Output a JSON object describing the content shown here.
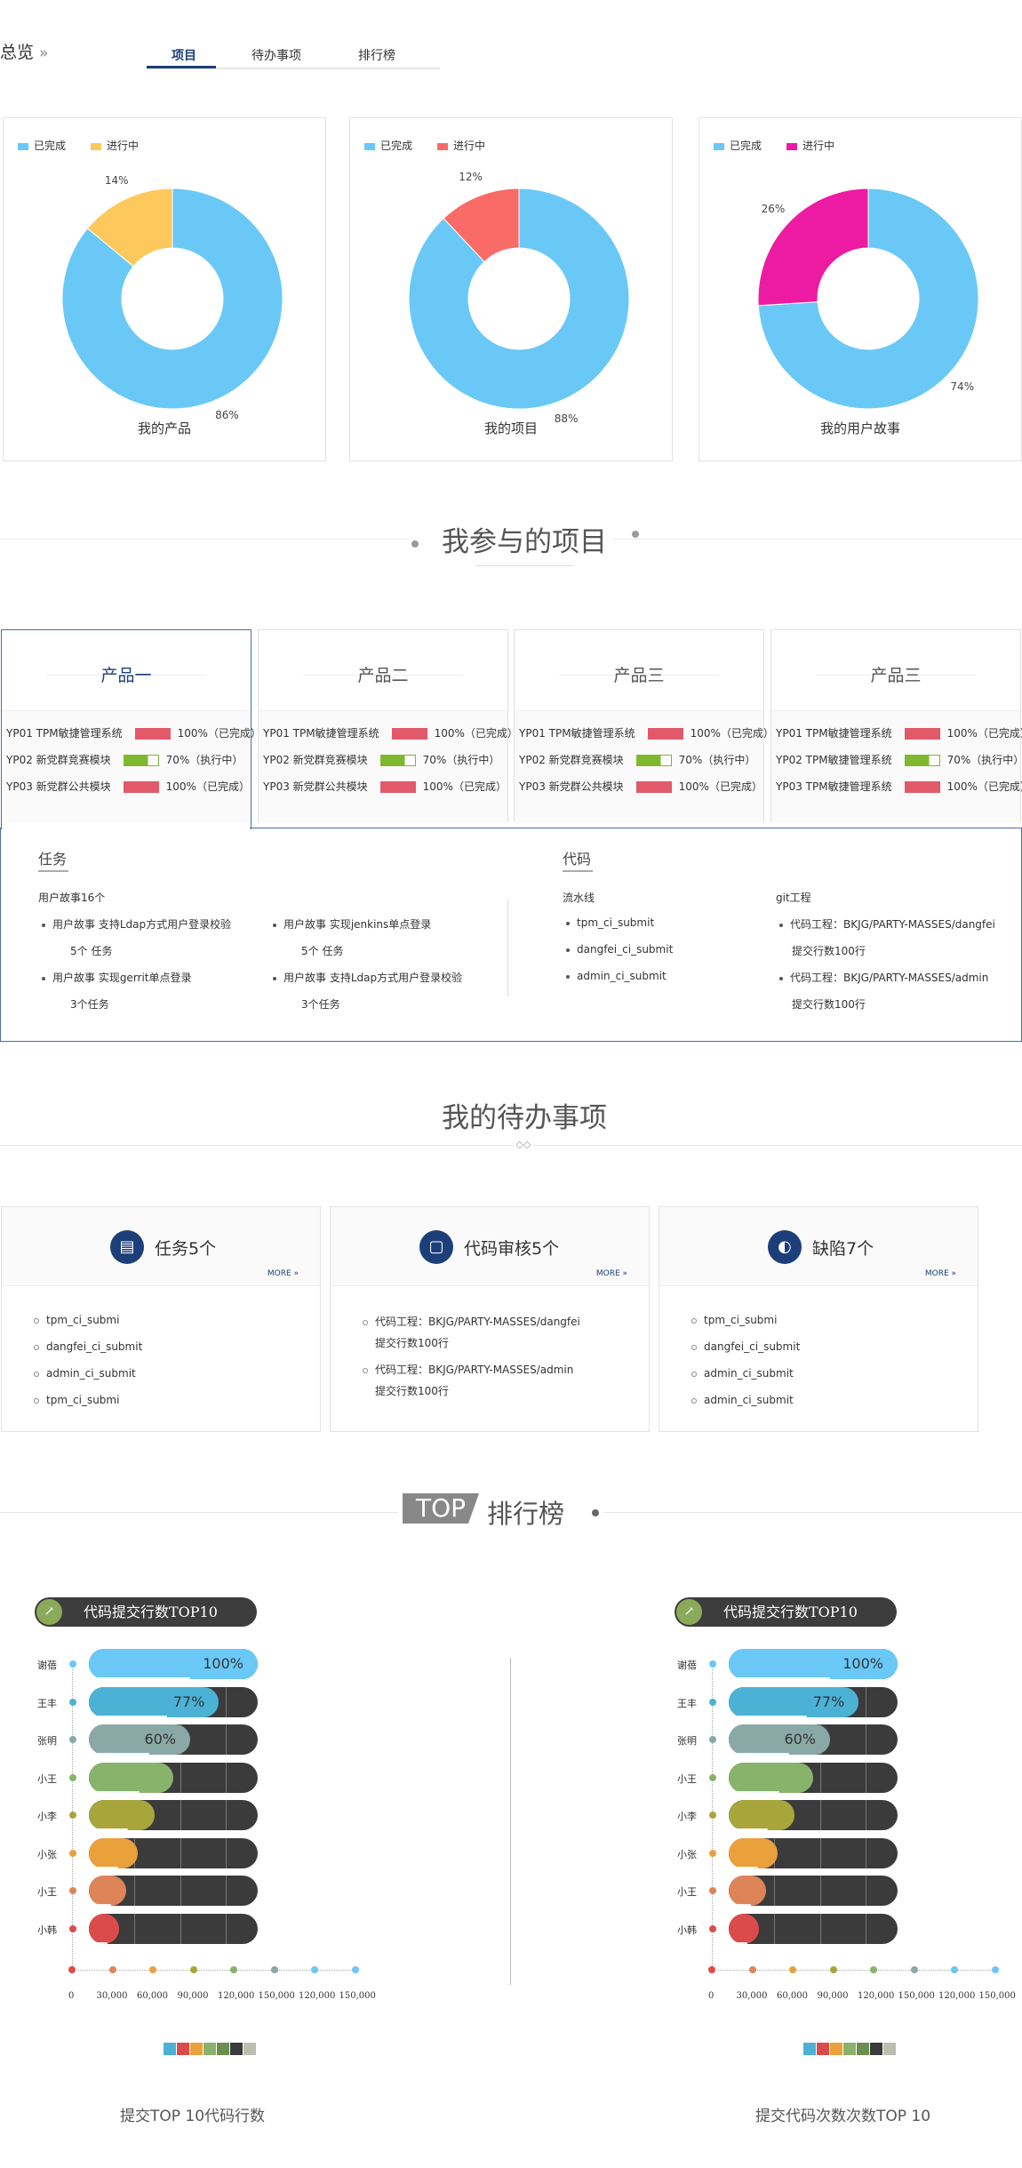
{
  "header": {
    "title": "总览",
    "chevron": "»",
    "tabs": [
      {
        "label": "项目",
        "active": true
      },
      {
        "label": "待办事项",
        "active": false
      },
      {
        "label": "排行榜",
        "active": false
      }
    ]
  },
  "pies": [
    {
      "title": "我的产品",
      "legend": [
        "已完成",
        "进行中"
      ],
      "colors": [
        "#6ac8f7",
        "#fdc95c"
      ],
      "done": 86,
      "doing": 14,
      "done_label": "86%",
      "doing_label": "14%"
    },
    {
      "title": "我的项目",
      "legend": [
        "已完成",
        "进行中"
      ],
      "colors": [
        "#6ac8f7",
        "#f86b67"
      ],
      "done": 88,
      "doing": 12,
      "done_label": "88%",
      "doing_label": "12%"
    },
    {
      "title": "我的用户故事",
      "legend": [
        "已完成",
        "进行中"
      ],
      "colors": [
        "#6ac8f7",
        "#ec1ba1"
      ],
      "done": 74,
      "doing": 26,
      "done_label": "74%",
      "doing_label": "26%"
    }
  ],
  "projects_section": {
    "title": "我参与的项目"
  },
  "products": [
    {
      "name": "产品一",
      "rows": [
        {
          "label": "YP01 TPM敏捷管理系统",
          "pct": "100%",
          "status": "（已完成）",
          "progress": 1.0
        },
        {
          "label": "YP02 新党群竞赛模块",
          "pct": "70%",
          "status": "（执行中）",
          "progress": 0.7
        },
        {
          "label": "YP03 新党群公共模块",
          "pct": "100%",
          "status": "（已完成）",
          "progress": 1.0
        }
      ]
    },
    {
      "name": "产品二",
      "rows": [
        {
          "label": "YP01 TPM敏捷管理系统",
          "pct": "100%",
          "status": "（已完成）",
          "progress": 1.0
        },
        {
          "label": "YP02 新党群竞赛模块",
          "pct": "70%",
          "status": "（执行中）",
          "progress": 0.7
        },
        {
          "label": "YP03 新党群公共模块",
          "pct": "100%",
          "status": "（已完成）",
          "progress": 1.0
        }
      ]
    },
    {
      "name": "产品三",
      "rows": [
        {
          "label": "YP01 TPM敏捷管理系统",
          "pct": "100%",
          "status": "（已完成）",
          "progress": 1.0
        },
        {
          "label": "YP02 新党群竞赛模块",
          "pct": "70%",
          "status": "（执行中）",
          "progress": 0.7
        },
        {
          "label": "YP03 新党群公共模块",
          "pct": "100%",
          "status": "（已完成）",
          "progress": 1.0
        }
      ]
    },
    {
      "name": "产品三",
      "rows": [
        {
          "label": "YP01 TPM敏捷管理系统",
          "pct": "100%",
          "status": "（已完成）",
          "progress": 1.0
        },
        {
          "label": "YP02 TPM敏捷管理系统",
          "pct": "70%",
          "status": "（执行中）",
          "progress": 0.7
        },
        {
          "label": "YP03 TPM敏捷管理系统",
          "pct": "100%",
          "status": "（已完成）",
          "progress": 1.0
        }
      ]
    }
  ],
  "detail": {
    "tasks_title": "任务",
    "tasks_summary": "用户故事16个",
    "tasks": [
      {
        "title": "用户故事 支持Ldap方式用户登录校验",
        "count": "5个 任务"
      },
      {
        "title": "用户故事 实现jenkins单点登录",
        "count": "5个 任务"
      },
      {
        "title": "用户故事 实现gerrit单点登录",
        "count": "3个任务"
      },
      {
        "title": "用户故事 支持Ldap方式用户登录校验",
        "count": "3个任务"
      }
    ],
    "code_title": "代码",
    "pipeline_title": "流水线",
    "pipelines": [
      "tpm_ci_submit",
      "dangfei_ci_submit",
      "admin_ci_submit"
    ],
    "git_title": "git工程",
    "git": [
      {
        "title": "代码工程：BKJG/PARTY-MASSES/dangfei",
        "lines": "提交行数100行"
      },
      {
        "title": "代码工程：BKJG/PARTY-MASSES/admin",
        "lines": "提交行数100行"
      }
    ]
  },
  "todo_section": {
    "title": "我的待办事项"
  },
  "todos": [
    {
      "title": "任务5个",
      "more": "MORE »",
      "icon": "printer-icon",
      "items": [
        "tpm_ci_submi",
        "dangfei_ci_submit",
        "admin_ci_submit",
        "tpm_ci_submi"
      ]
    },
    {
      "title": "代码审核5个",
      "more": "MORE »",
      "icon": "code-review-icon",
      "items": [
        "代码工程：BKJG/PARTY-MASSES/dangfei",
        "提交行数100行",
        "代码工程：BKJG/PARTY-MASSES/admin",
        "提交行数100行"
      ]
    },
    {
      "title": "缺陷7个",
      "more": "MORE »",
      "icon": "refresh-icon",
      "items": [
        "tpm_ci_submi",
        "dangfei_ci_submit",
        "admin_ci_submit",
        "admin_ci_submit"
      ]
    }
  ],
  "ranking_section": {
    "badge": "TOP",
    "title": "排行榜"
  },
  "chart_data": [
    {
      "type": "bar",
      "title": "代码提交行数TOP10",
      "footer": "提交TOP 10代码行数",
      "categories": [
        "谢蓓",
        "王丰",
        "张明",
        "小王",
        "小李",
        "小张",
        "小王",
        "小韩"
      ],
      "values": [
        100,
        77,
        60,
        50,
        39,
        29,
        22,
        18
      ],
      "value_labels": [
        "100%",
        "77%",
        "60%",
        "",
        "",
        "",
        "",
        ""
      ],
      "colors": [
        "#6ac8f7",
        "#4bb2d6",
        "#8aa8a6",
        "#88b36b",
        "#a8a53c",
        "#eaa03b",
        "#dd8458",
        "#dc4b4b"
      ],
      "xticks": [
        "0",
        "30,000",
        "60,000",
        "90,000",
        "120,000",
        "150,000",
        "120,000",
        "150,000"
      ],
      "swatches": [
        "#4bb2d6",
        "#dc4b4b",
        "#eaa03b",
        "#88b36b",
        "#6b8e4e",
        "#3b3b3b",
        "#bdbdb0"
      ]
    },
    {
      "type": "bar",
      "title": "代码提交行数TOP10",
      "footer": "提交代码次数次数TOP 10",
      "categories": [
        "谢蓓",
        "王丰",
        "张明",
        "小王",
        "小李",
        "小张",
        "小王",
        "小韩"
      ],
      "values": [
        100,
        77,
        60,
        50,
        39,
        29,
        22,
        18
      ],
      "value_labels": [
        "100%",
        "77%",
        "60%",
        "",
        "",
        "",
        "",
        ""
      ],
      "colors": [
        "#6ac8f7",
        "#4bb2d6",
        "#8aa8a6",
        "#88b36b",
        "#a8a53c",
        "#eaa03b",
        "#dd8458",
        "#dc4b4b"
      ],
      "xticks": [
        "0",
        "30,000",
        "60,000",
        "90,000",
        "120,000",
        "150,000",
        "120,000",
        "150,000"
      ],
      "swatches": [
        "#4bb2d6",
        "#dc4b4b",
        "#eaa03b",
        "#88b36b",
        "#6b8e4e",
        "#3b3b3b",
        "#bdbdb0"
      ]
    }
  ]
}
